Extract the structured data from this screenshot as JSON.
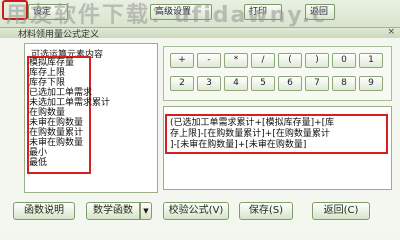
{
  "watermark": "用友软件下载：ufidawny.c",
  "toolbar": {
    "b1": "设定",
    "b2": "高级设置",
    "b3": "打印",
    "b4": "返回"
  },
  "dialog": {
    "title": "材料领用量公式定义",
    "close": "×"
  },
  "elements": {
    "heading": "可选运算元素内容",
    "items": [
      "模拟库存量",
      "库存上限",
      "库存下限",
      "已选加工单需求",
      "未选加工单需求累计",
      "在购数量",
      "未审在购数量",
      "在购数量累计",
      "未审在购数量",
      "最小",
      "最低"
    ]
  },
  "keypad": {
    "row1": [
      "+",
      "-",
      "*",
      "/",
      "(",
      ")",
      "0",
      "1"
    ],
    "row2": [
      "2",
      "3",
      "4",
      "5",
      "6",
      "7",
      "8",
      "9"
    ]
  },
  "formula": {
    "lines": [
      "(已选加工单需求累计+[模拟库存量]+[库",
      "存上限]-[在购数量累计]+[在购数量累计",
      "]-[未审在购数量]+[未审在购数量]"
    ]
  },
  "buttons": {
    "func_help": "函数说明",
    "math_func": "数学函数",
    "math_arrow": "▼",
    "validate": "校验公式",
    "validate_hint": "(V)",
    "save": "保存",
    "save_hint": "(S)",
    "back": "返回",
    "back_hint": "(C)"
  }
}
